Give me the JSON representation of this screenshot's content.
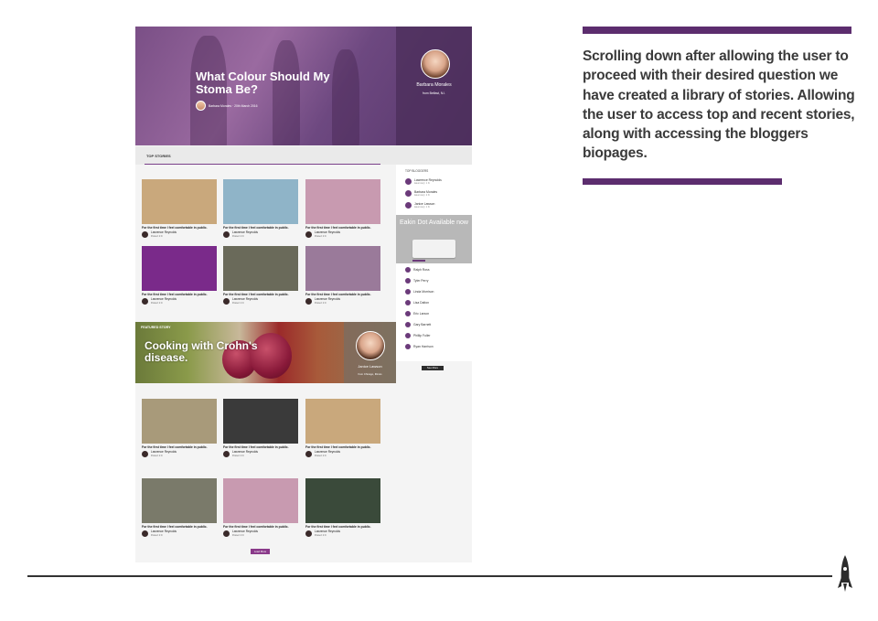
{
  "hero": {
    "title": "What Colour Should My Stoma Be?",
    "meta": "Barbara Morales · 20th March 2016",
    "panel_name": "Barbara Morales",
    "panel_from": "from Belfast, N.I."
  },
  "tabs": {
    "top_stories": "TOP STORIES"
  },
  "cards": [
    {
      "title": "For the first time I feel comfortable in public.",
      "author": "Lawrence Reynolds",
      "posted": "Posted: 2 hr",
      "color": "#c9a87c"
    },
    {
      "title": "For the first time I feel comfortable in public.",
      "author": "Lawrence Reynolds",
      "posted": "Posted: 2 hr",
      "color": "#8fb4c8"
    },
    {
      "title": "For the first time I feel comfortable in public.",
      "author": "Lawrence Reynolds",
      "posted": "Posted: 2 hr",
      "color": "#c89ab0"
    },
    {
      "title": "For the first time I feel comfortable in public.",
      "author": "Lawrence Reynolds",
      "posted": "Posted: 2 hr",
      "color": "#7a2a8a"
    },
    {
      "title": "For the first time I feel comfortable in public.",
      "author": "Lawrence Reynolds",
      "posted": "Posted: 2 hr",
      "color": "#6a6a5a"
    },
    {
      "title": "For the first time I feel comfortable in public.",
      "author": "Lawrence Reynolds",
      "posted": "Posted: 2 hr",
      "color": "#9a7a9a"
    },
    {
      "title": "For the first time I feel comfortable in public.",
      "author": "Lawrence Reynolds",
      "posted": "Posted: 2 hr",
      "color": "#a89a7a"
    },
    {
      "title": "For the first time I feel comfortable in public.",
      "author": "Lawrence Reynolds",
      "posted": "Posted: 2 hr",
      "color": "#3a3a3a"
    },
    {
      "title": "For the first time I feel comfortable in public.",
      "author": "Lawrence Reynolds",
      "posted": "Posted: 2 hr",
      "color": "#c9a87c"
    },
    {
      "title": "For the first time I feel comfortable in public.",
      "author": "Lawrence Reynolds",
      "posted": "Posted: 2 hr",
      "color": "#7a7a6a"
    },
    {
      "title": "For the first time I feel comfortable in public.",
      "author": "Lawrence Reynolds",
      "posted": "Posted: 2 hr",
      "color": "#c89ab0"
    },
    {
      "title": "For the first time I feel comfortable in public.",
      "author": "Lawrence Reynolds",
      "posted": "Posted: 2 hr",
      "color": "#3a4a3a"
    }
  ],
  "sidebar": {
    "title": "TOP BLOGGERS",
    "top": [
      {
        "name": "Lawrence Reynolds",
        "sub": "latest story: 1 hr"
      },
      {
        "name": "Barbara Morales",
        "sub": "latest story: 2 hr"
      },
      {
        "name": "Janice Lawson",
        "sub": "latest story: 1 hr"
      }
    ],
    "ad_title": "Eakin Dot Available now",
    "list": [
      "Ralph Ross",
      "Tyler Perry",
      "Linda Morrison",
      "Lisa Dalton",
      "Eric Larson",
      "Gary Barnett",
      "Phillip Fuller",
      "Ryan Harrison"
    ],
    "see_more": "See More"
  },
  "featured": {
    "label": "FEATURED STORY",
    "title": "Cooking with Crohn's disease.",
    "name": "Janice Lawson",
    "from": "from Chicago, Illinois"
  },
  "load_more": "Load More",
  "description": "Scrolling down after allowing the user to proceed with their desired question we have created a library of stories. Allowing the user to access top and recent stories, along with accessing the bloggers biopages.",
  "colors": {
    "accent": "#5c2d6e",
    "button": "#8a3a8a"
  }
}
